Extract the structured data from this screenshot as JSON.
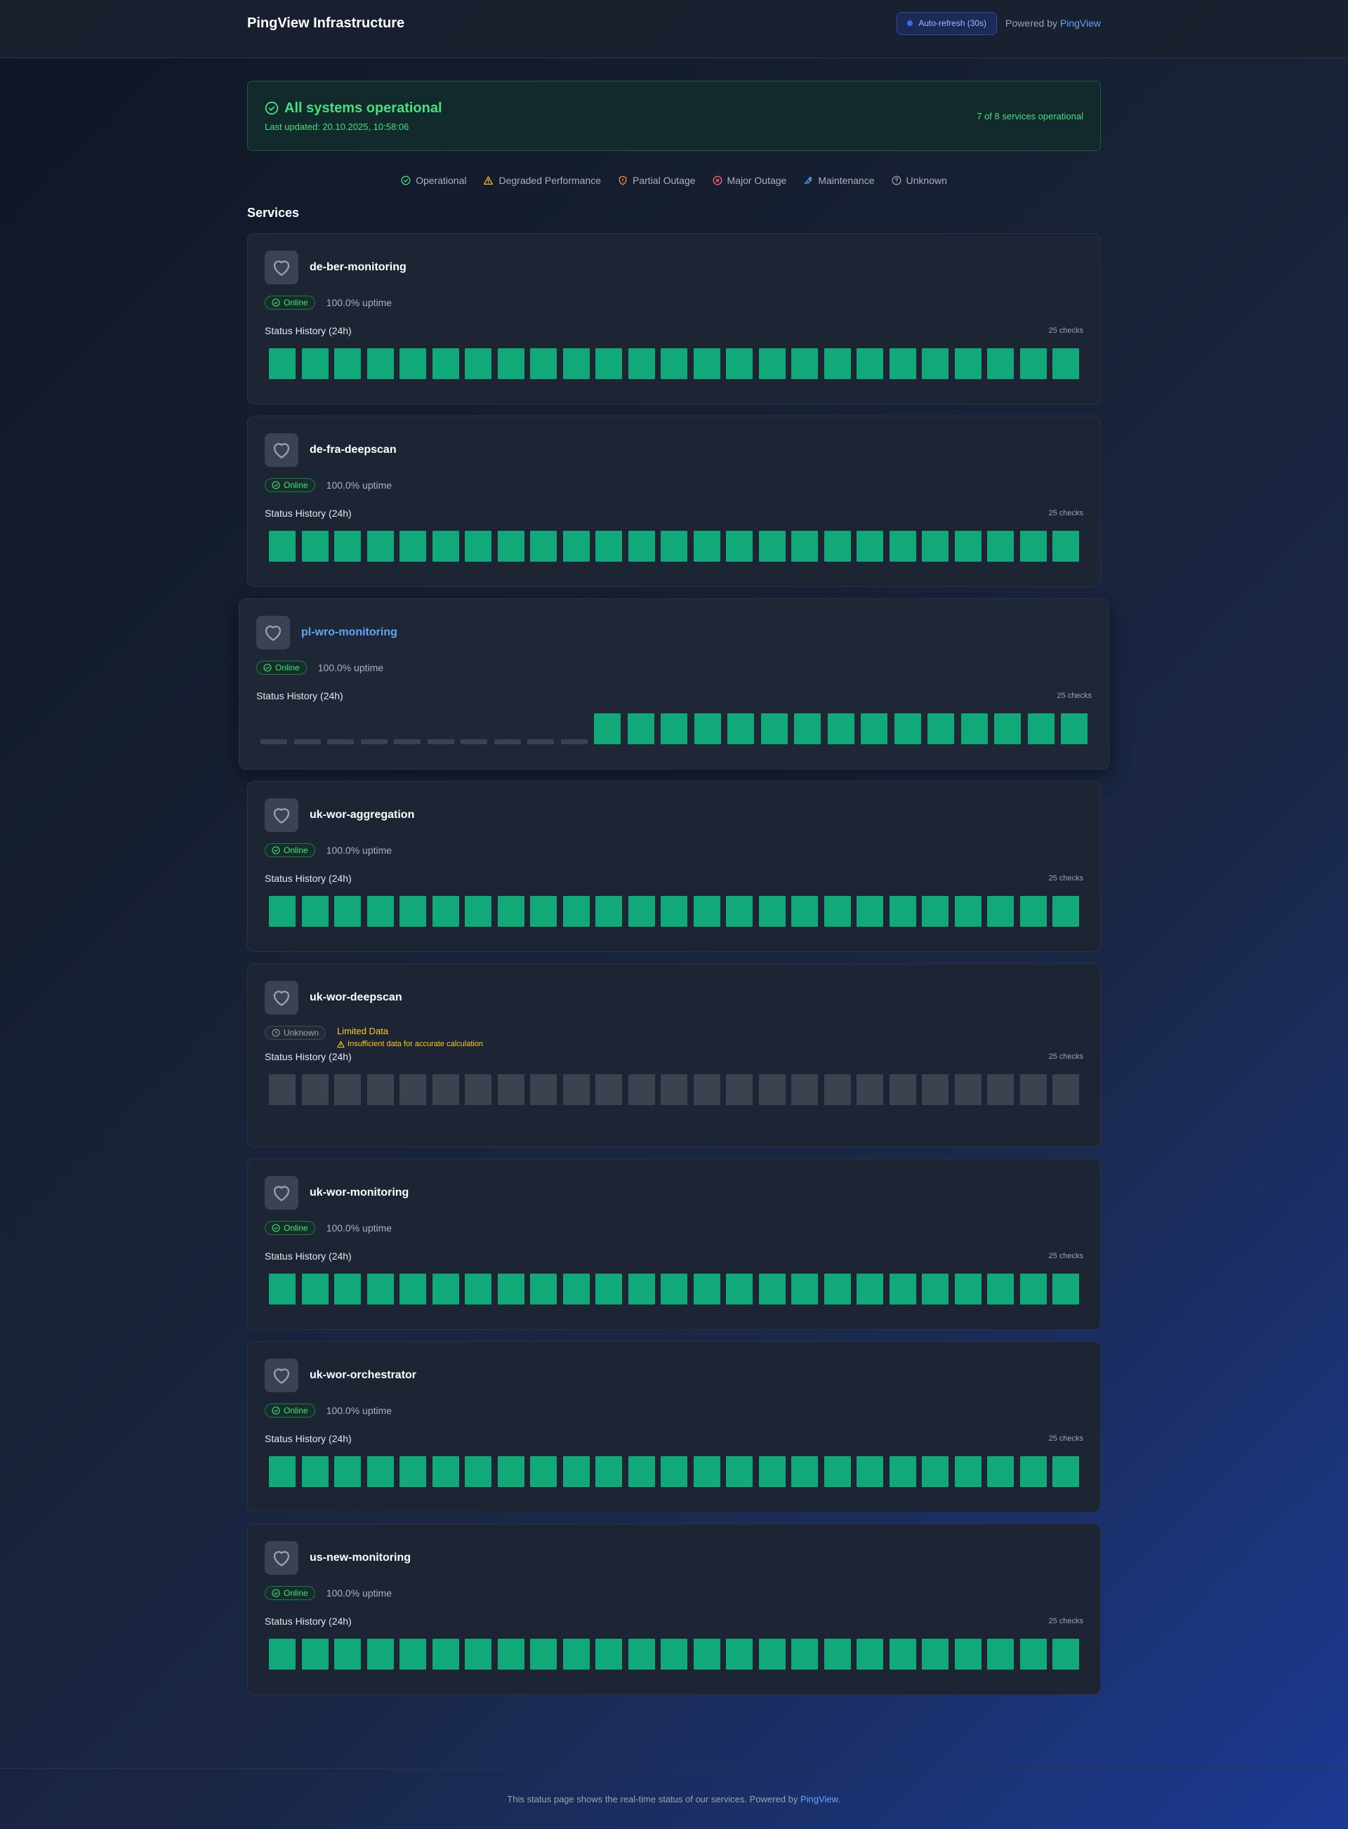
{
  "header": {
    "title": "PingView Infrastructure",
    "auto_refresh": "Auto-refresh (30s)",
    "powered_prefix": "Powered by",
    "powered_brand": "PingView"
  },
  "overall": {
    "title": "All systems operational",
    "updated": "Last updated: 20.10.2025, 10:58:06",
    "count": "7 of 8 services operational",
    "color": "#4ade80"
  },
  "legend": [
    {
      "label": "Operational",
      "icon": "check-circle-icon",
      "color": "#4ade80"
    },
    {
      "label": "Degraded Performance",
      "icon": "warning-triangle-icon",
      "color": "#facc15"
    },
    {
      "label": "Partial Outage",
      "icon": "shield-alert-icon",
      "color": "#fb923c"
    },
    {
      "label": "Major Outage",
      "icon": "x-circle-icon",
      "color": "#f87171"
    },
    {
      "label": "Maintenance",
      "icon": "wrench-icon",
      "color": "#60a5fa"
    },
    {
      "label": "Unknown",
      "icon": "question-circle-icon",
      "color": "#9ca3af"
    }
  ],
  "services_title": "Services",
  "history_label": "Status History (24h)",
  "services": [
    {
      "name": "de-ber-monitoring",
      "status": "Online",
      "uptime": "100.0% uptime",
      "checks": "25 checks",
      "history": {
        "total": 25,
        "up": 25,
        "empty": 0,
        "unknown": 0
      }
    },
    {
      "name": "de-fra-deepscan",
      "status": "Online",
      "uptime": "100.0% uptime",
      "checks": "25 checks",
      "history": {
        "total": 25,
        "up": 25,
        "empty": 0,
        "unknown": 0
      }
    },
    {
      "name": "pl-wro-monitoring",
      "status": "Online",
      "uptime": "100.0% uptime",
      "checks": "25 checks",
      "hovered": true,
      "history": {
        "total": 25,
        "up": 15,
        "empty": 10,
        "unknown": 0
      }
    },
    {
      "name": "uk-wor-aggregation",
      "status": "Online",
      "uptime": "100.0% uptime",
      "checks": "25 checks",
      "history": {
        "total": 25,
        "up": 25,
        "empty": 0,
        "unknown": 0
      }
    },
    {
      "name": "uk-wor-deepscan",
      "status": "Unknown",
      "limited_title": "Limited Data",
      "limited_note": "Insufficient data for accurate calculation",
      "checks": "25 checks",
      "history": {
        "total": 25,
        "up": 0,
        "empty": 0,
        "unknown": 25
      }
    },
    {
      "name": "uk-wor-monitoring",
      "status": "Online",
      "uptime": "100.0% uptime",
      "checks": "25 checks",
      "history": {
        "total": 25,
        "up": 25,
        "empty": 0,
        "unknown": 0
      }
    },
    {
      "name": "uk-wor-orchestrator",
      "status": "Online",
      "uptime": "100.0% uptime",
      "checks": "25 checks",
      "history": {
        "total": 25,
        "up": 25,
        "empty": 0,
        "unknown": 0
      }
    },
    {
      "name": "us-new-monitoring",
      "status": "Online",
      "uptime": "100.0% uptime",
      "checks": "25 checks",
      "history": {
        "total": 25,
        "up": 25,
        "empty": 0,
        "unknown": 0
      }
    }
  ],
  "footer": {
    "text": "This status page shows the real-time status of our services. Powered by",
    "brand": "PingView",
    "suffix": "."
  }
}
